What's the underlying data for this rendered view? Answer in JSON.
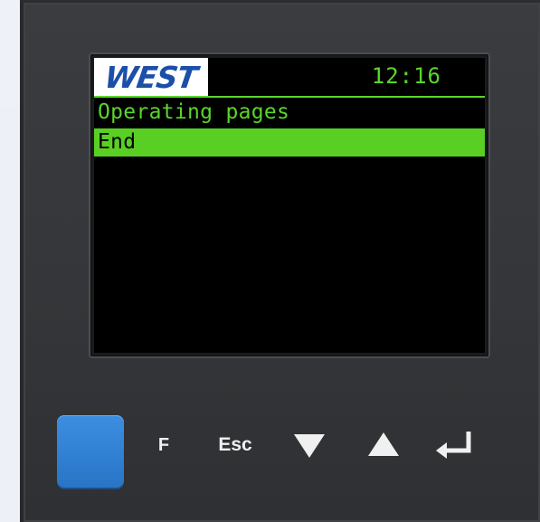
{
  "device": {
    "brand": "WEST",
    "clock": "12:16",
    "menu_title": "Operating pages",
    "selected_item": "End"
  },
  "keys": {
    "function_label": "F",
    "escape_label": "Esc",
    "down_icon": "triangle-down-icon",
    "up_icon": "triangle-up-icon",
    "enter_icon": "enter-return-icon",
    "blue_key_icon": "blank-square-key"
  },
  "colors": {
    "display_green": "#59d62a",
    "selection_bar": "#59cf24",
    "brand_blue": "#1b4fa8",
    "key_blue": "#2f7fd3",
    "device_body": "#36383b"
  }
}
